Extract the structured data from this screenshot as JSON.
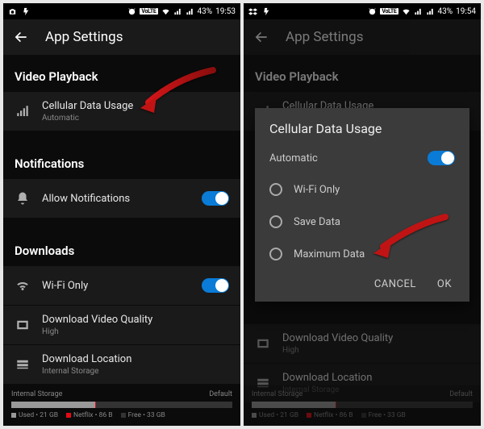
{
  "status": {
    "battery_pct": "43%",
    "time_a": "19:53",
    "time_b": "19:54",
    "volte": "VoLTE"
  },
  "appbar": {
    "title": "App Settings"
  },
  "sections": {
    "video": {
      "header": "Video Playback",
      "cellular": {
        "title": "Cellular Data Usage",
        "sub": "Automatic"
      }
    },
    "notif": {
      "header": "Notifications",
      "allow": {
        "title": "Allow Notifications"
      }
    },
    "dl": {
      "header": "Downloads",
      "wifi": {
        "title": "Wi-Fi Only"
      },
      "quality": {
        "title": "Download Video Quality",
        "sub": "High"
      },
      "location": {
        "title": "Download Location",
        "sub": "Internal Storage"
      }
    }
  },
  "storage": {
    "label": "Internal Storage",
    "default": "Default",
    "used": "Used • 21 GB",
    "netflix": "Netflix • 86 B",
    "free": "Free • 33 GB"
  },
  "dialog": {
    "title": "Cellular Data Usage",
    "auto": "Automatic",
    "opt1": "Wi-Fi Only",
    "opt2": "Save Data",
    "opt3": "Maximum Data",
    "cancel": "CANCEL",
    "ok": "OK"
  }
}
